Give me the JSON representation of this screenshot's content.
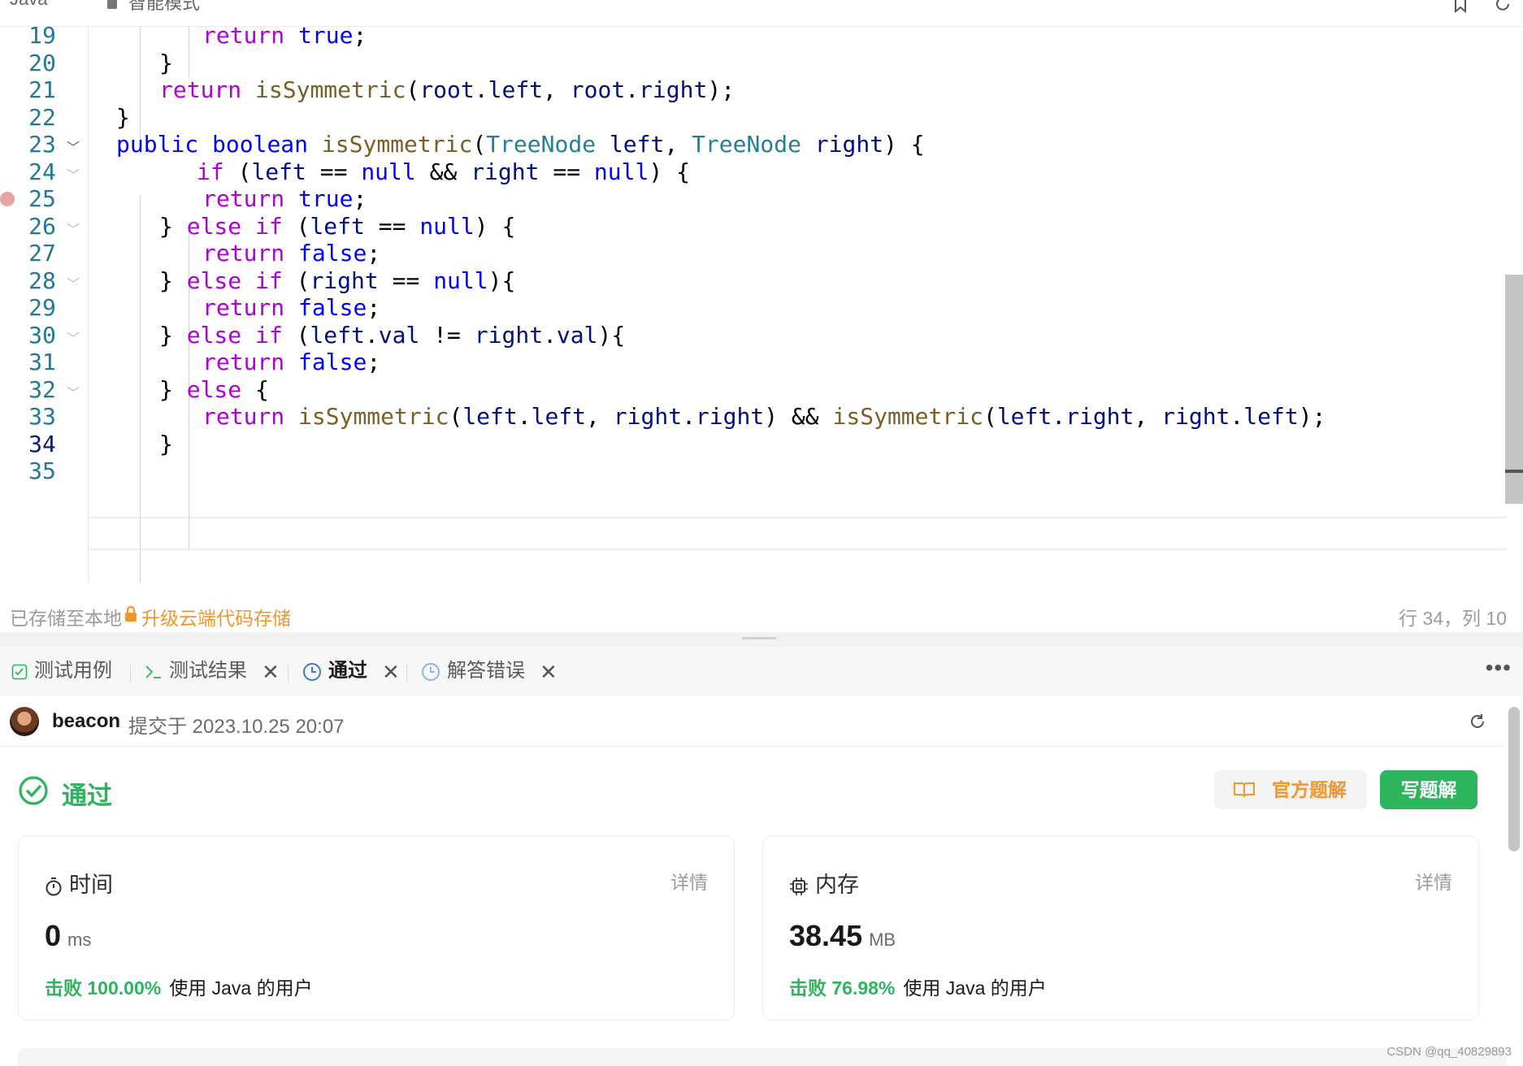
{
  "topbar": {
    "language": "Java",
    "mode": "智能模式"
  },
  "editor": {
    "current_line": 34,
    "lines": [
      {
        "n": "19",
        "tokens": [
          [
            "k",
            "return"
          ],
          [
            "p",
            " "
          ],
          [
            "t",
            "true"
          ],
          [
            "p",
            ";"
          ]
        ]
      },
      {
        "n": "20",
        "tokens": [
          [
            "p",
            "}"
          ]
        ]
      },
      {
        "n": "21",
        "tokens": [
          [
            "k",
            "return"
          ],
          [
            "p",
            " "
          ],
          [
            "f",
            "isSymmetric"
          ],
          [
            "p",
            "("
          ],
          [
            "i",
            "root"
          ],
          [
            "p",
            "."
          ],
          [
            "i",
            "left"
          ],
          [
            "p",
            ", "
          ],
          [
            "i",
            "root"
          ],
          [
            "p",
            "."
          ],
          [
            "i",
            "right"
          ],
          [
            "p",
            ");"
          ]
        ]
      },
      {
        "n": "22",
        "tokens": [
          [
            "p",
            "}"
          ]
        ]
      },
      {
        "n": "23",
        "tokens": [
          [
            "t",
            "public"
          ],
          [
            "p",
            " "
          ],
          [
            "t",
            "boolean"
          ],
          [
            "p",
            " "
          ],
          [
            "f",
            "isSymmetric"
          ],
          [
            "p",
            "("
          ],
          [
            "c",
            "TreeNode"
          ],
          [
            "p",
            " "
          ],
          [
            "i",
            "left"
          ],
          [
            "p",
            ", "
          ],
          [
            "c",
            "TreeNode"
          ],
          [
            "p",
            " "
          ],
          [
            "i",
            "right"
          ],
          [
            "p",
            ") {"
          ]
        ]
      },
      {
        "n": "24",
        "tokens": [
          [
            "k",
            "if"
          ],
          [
            "p",
            " ("
          ],
          [
            "i",
            "left"
          ],
          [
            "p",
            " == "
          ],
          [
            "t",
            "null"
          ],
          [
            "p",
            " && "
          ],
          [
            "i",
            "right"
          ],
          [
            "p",
            " == "
          ],
          [
            "t",
            "null"
          ],
          [
            "p",
            ") {"
          ]
        ]
      },
      {
        "n": "25",
        "tokens": [
          [
            "k",
            "return"
          ],
          [
            "p",
            " "
          ],
          [
            "t",
            "true"
          ],
          [
            "p",
            ";"
          ]
        ]
      },
      {
        "n": "26",
        "tokens": [
          [
            "p",
            "} "
          ],
          [
            "k",
            "else"
          ],
          [
            "p",
            " "
          ],
          [
            "k",
            "if"
          ],
          [
            "p",
            " ("
          ],
          [
            "i",
            "left"
          ],
          [
            "p",
            " == "
          ],
          [
            "t",
            "null"
          ],
          [
            "p",
            ") {"
          ]
        ]
      },
      {
        "n": "27",
        "tokens": [
          [
            "k",
            "return"
          ],
          [
            "p",
            " "
          ],
          [
            "t",
            "false"
          ],
          [
            "p",
            ";"
          ]
        ]
      },
      {
        "n": "28",
        "tokens": [
          [
            "p",
            "} "
          ],
          [
            "k",
            "else"
          ],
          [
            "p",
            " "
          ],
          [
            "k",
            "if"
          ],
          [
            "p",
            " ("
          ],
          [
            "i",
            "right"
          ],
          [
            "p",
            " == "
          ],
          [
            "t",
            "null"
          ],
          [
            "p",
            "){"
          ]
        ]
      },
      {
        "n": "29",
        "tokens": [
          [
            "k",
            "return"
          ],
          [
            "p",
            " "
          ],
          [
            "t",
            "false"
          ],
          [
            "p",
            ";"
          ]
        ]
      },
      {
        "n": "30",
        "tokens": [
          [
            "p",
            "} "
          ],
          [
            "k",
            "else"
          ],
          [
            "p",
            " "
          ],
          [
            "k",
            "if"
          ],
          [
            "p",
            " ("
          ],
          [
            "i",
            "left"
          ],
          [
            "p",
            "."
          ],
          [
            "i",
            "val"
          ],
          [
            "p",
            " != "
          ],
          [
            "i",
            "right"
          ],
          [
            "p",
            "."
          ],
          [
            "i",
            "val"
          ],
          [
            "p",
            "){"
          ]
        ]
      },
      {
        "n": "31",
        "tokens": [
          [
            "k",
            "return"
          ],
          [
            "p",
            " "
          ],
          [
            "t",
            "false"
          ],
          [
            "p",
            ";"
          ]
        ]
      },
      {
        "n": "32",
        "tokens": [
          [
            "p",
            "} "
          ],
          [
            "k",
            "else"
          ],
          [
            "p",
            " {"
          ]
        ]
      },
      {
        "n": "33",
        "tokens": [
          [
            "k",
            "return"
          ],
          [
            "p",
            " "
          ],
          [
            "f",
            "isSymmetric"
          ],
          [
            "p",
            "("
          ],
          [
            "i",
            "left"
          ],
          [
            "p",
            "."
          ],
          [
            "i",
            "left"
          ],
          [
            "p",
            ", "
          ],
          [
            "i",
            "right"
          ],
          [
            "p",
            "."
          ],
          [
            "i",
            "right"
          ],
          [
            "p",
            ") && "
          ],
          [
            "f",
            "isSymmetric"
          ],
          [
            "p",
            "("
          ],
          [
            "i",
            "left"
          ],
          [
            "p",
            "."
          ],
          [
            "i",
            "right"
          ],
          [
            "p",
            ", "
          ],
          [
            "i",
            "right"
          ],
          [
            "p",
            "."
          ],
          [
            "i",
            "left"
          ],
          [
            "p",
            ");"
          ]
        ]
      },
      {
        "n": "34",
        "tokens": [
          [
            "p",
            "}"
          ]
        ]
      },
      {
        "n": "35",
        "tokens": []
      }
    ]
  },
  "status": {
    "saved": "已存储至本地",
    "upgrade": "升级云端代码存储",
    "cursor": "行 34，列 10"
  },
  "tabs": [
    {
      "label": "测试用例",
      "icon": "checkbox-icon",
      "closable": false,
      "active": false
    },
    {
      "label": "测试结果",
      "icon": "terminal-icon",
      "closable": true,
      "active": false
    },
    {
      "label": "通过",
      "icon": "clock-icon",
      "closable": true,
      "active": true
    },
    {
      "label": "解答错误",
      "icon": "clock-icon",
      "closable": true,
      "active": false
    }
  ],
  "submission": {
    "user": "beacon",
    "submitted_at": "提交于 2023.10.25 20:07"
  },
  "result": {
    "status": "通过",
    "official_solution": "官方题解",
    "write_solution": "写题解"
  },
  "metrics": {
    "time": {
      "title": "时间",
      "detail": "详情",
      "value": "0",
      "unit": "ms",
      "beat": "击败 100.00%",
      "beat_suffix": "使用 Java 的用户"
    },
    "memory": {
      "title": "内存",
      "detail": "详情",
      "value": "38.45",
      "unit": "MB",
      "beat": "击败 76.98%",
      "beat_suffix": "使用 Java 的用户"
    }
  },
  "watermark": "CSDN @qq_40829893",
  "colors": {
    "accent_green": "#2db55d",
    "accent_orange": "#f3962e",
    "active_tab_blue": "#3a7bd5"
  }
}
